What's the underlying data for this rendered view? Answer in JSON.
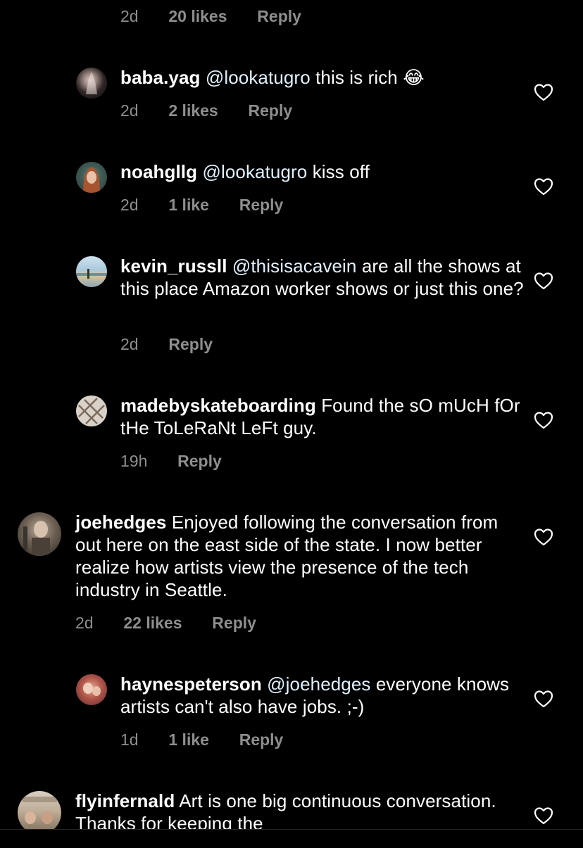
{
  "colors": {
    "background": "#000000",
    "text": "#ffffff",
    "meta": "#8e8e8e",
    "mention": "#e0f1ff"
  },
  "icons": {
    "like": "heart-outline-icon"
  },
  "top_meta": {
    "time": "2d",
    "likes": "20 likes",
    "reply": "Reply"
  },
  "comments": [
    {
      "username": "baba.yag",
      "mention": "@lookatugro",
      "text": " this is rich 😂",
      "time": "2d",
      "likes": "2 likes",
      "reply": "Reply"
    },
    {
      "username": "noahgllg",
      "mention": "@lookatugro",
      "text": " kiss off",
      "time": "2d",
      "likes": "1 like",
      "reply": "Reply"
    },
    {
      "username": "kevin_russll",
      "mention": "@thisisacavein",
      "text": " are all the shows at this place Amazon worker shows or just this one?",
      "time": "2d",
      "likes": "",
      "reply": "Reply"
    },
    {
      "username": "madebyskateboarding",
      "mention": "",
      "text": " Found the sO mUcH fOr tHe ToLeRaNt LeFt guy.",
      "time": "19h",
      "likes": "",
      "reply": "Reply"
    },
    {
      "username": "joehedges",
      "mention": "",
      "text": " Enjoyed following the conversation from out here on the east side of the state. I now better realize how artists view the presence of the tech industry in Seattle.",
      "time": "2d",
      "likes": "22 likes",
      "reply": "Reply"
    },
    {
      "username": "haynespeterson",
      "mention": "@joehedges",
      "text": " everyone knows artists can't also have jobs. ;-)",
      "time": "1d",
      "likes": "1 like",
      "reply": "Reply"
    },
    {
      "username": "flyinfernald",
      "mention": "",
      "text": " Art is one big continuous conversation. Thanks for keeping the",
      "time": "",
      "likes": "",
      "reply": ""
    }
  ]
}
